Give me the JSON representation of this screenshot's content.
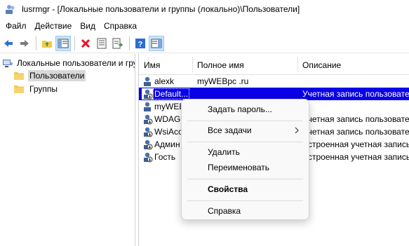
{
  "window": {
    "title": "lusrmgr - [Локальные пользователи и группы (локально)\\Пользователи]"
  },
  "menu": [
    "Файл",
    "Действие",
    "Вид",
    "Справка"
  ],
  "tree": {
    "root": "Локальные пользователи и группы (локально)",
    "children": [
      "Пользователи",
      "Группы"
    ]
  },
  "columns": {
    "name": "Имя",
    "fullname": "Полное имя",
    "description": "Описание"
  },
  "rows": [
    {
      "name": "alexk",
      "fullname": "myWEBpc .ru",
      "description": ""
    },
    {
      "name": "Default...",
      "fullname": "",
      "description": "Учетная запись пользовате"
    },
    {
      "name": "myWEB",
      "fullname": "",
      "description": ""
    },
    {
      "name": "WDAGU",
      "fullname": "",
      "description": "Учетная запись пользовате"
    },
    {
      "name": "WsiAcc",
      "fullname": "",
      "description": "Учетная запись пользовате"
    },
    {
      "name": "Админ",
      "fullname": "",
      "description": "Встроенная учетная запись"
    },
    {
      "name": "Гость",
      "fullname": "",
      "description": "Встроенная учетная запись"
    }
  ],
  "context_menu": {
    "set_password": "Задать пароль...",
    "all_tasks": "Все задачи",
    "delete": "Удалить",
    "rename": "Переименовать",
    "properties": "Свойства",
    "help": "Справка"
  },
  "colors": {
    "selection": "#0a00e6",
    "folder": "#f2c94c",
    "delete": "#e81123",
    "help": "#2b6cd8"
  }
}
